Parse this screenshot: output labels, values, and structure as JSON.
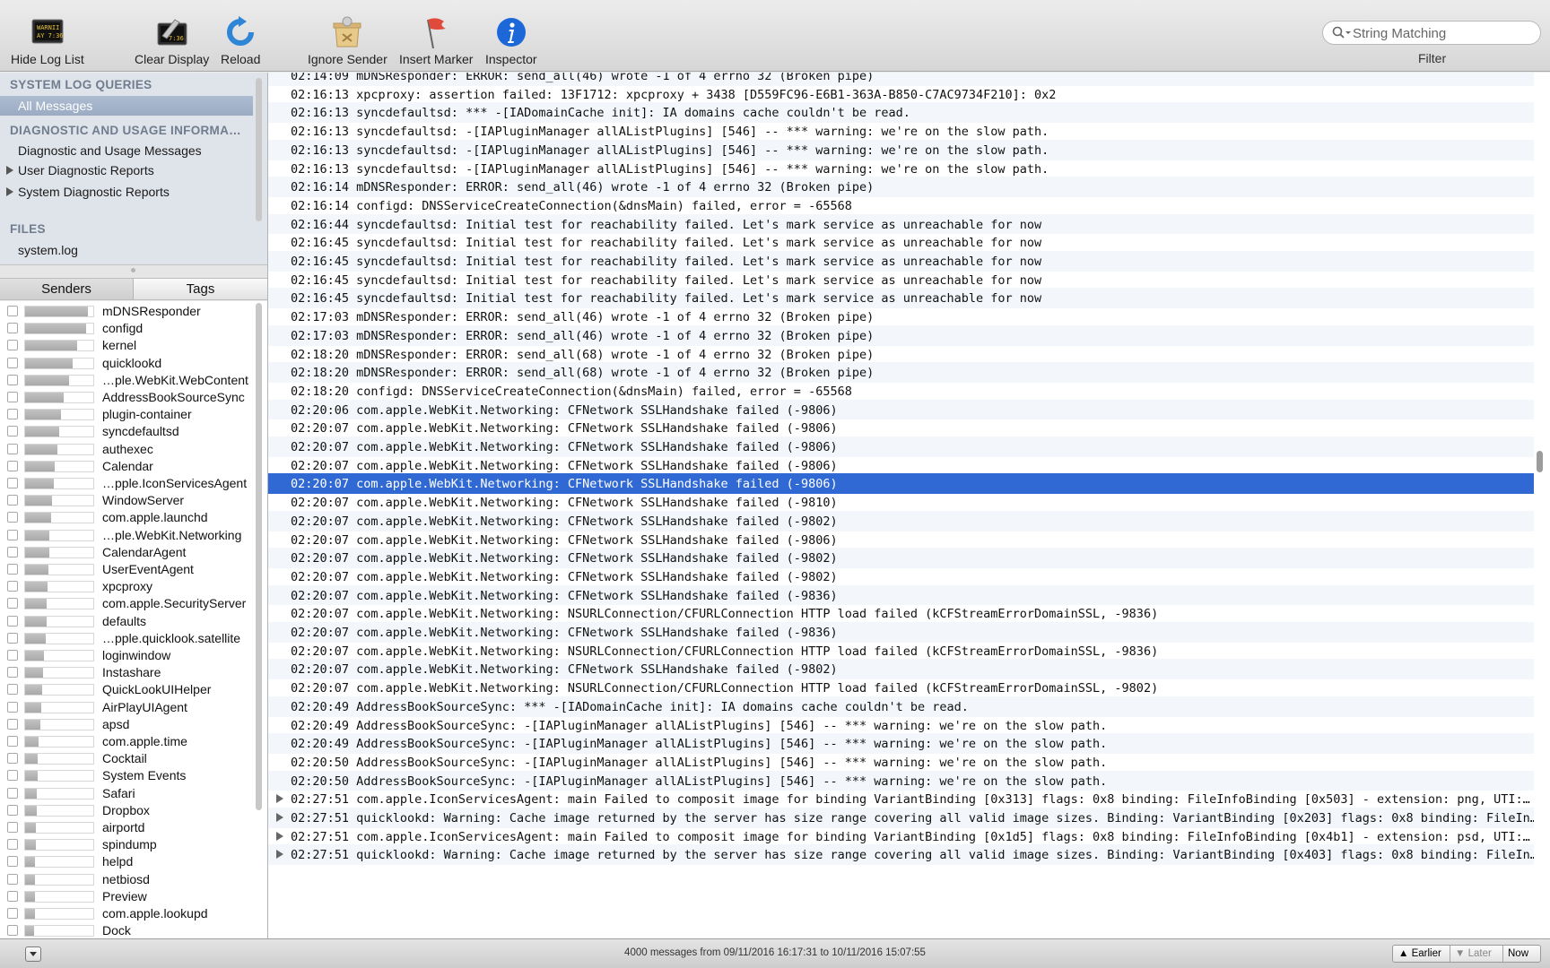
{
  "toolbar": {
    "hide_log_list": "Hide Log List",
    "clear_display": "Clear Display",
    "reload": "Reload",
    "ignore_sender": "Ignore Sender",
    "insert_marker": "Insert Marker",
    "inspector": "Inspector",
    "search_placeholder": "String Matching",
    "filter_label": "Filter",
    "console_icon_text_1": "WARNII",
    "console_icon_text_2": "AY 7:36",
    "clear_icon_text": "7:36"
  },
  "sidebar": {
    "system_log_queries": "SYSTEM LOG QUERIES",
    "all_messages": "All Messages",
    "diagnostic_header": "DIAGNOSTIC AND USAGE INFORMA…",
    "diagnostic_messages": "Diagnostic and Usage Messages",
    "user_reports": "User Diagnostic Reports",
    "system_reports": "System Diagnostic Reports",
    "files_header": "FILES",
    "system_log": "system.log"
  },
  "tabs": {
    "senders": "Senders",
    "tags": "Tags"
  },
  "senders": [
    {
      "name": "mDNSResponder",
      "level": 0.92
    },
    {
      "name": "configd",
      "level": 0.9
    },
    {
      "name": "kernel",
      "level": 0.76
    },
    {
      "name": "quicklookd",
      "level": 0.7
    },
    {
      "name": "…ple.WebKit.WebContent",
      "level": 0.64
    },
    {
      "name": "AddressBookSourceSync",
      "level": 0.57
    },
    {
      "name": "plugin-container",
      "level": 0.52
    },
    {
      "name": "syncdefaultsd",
      "level": 0.5
    },
    {
      "name": "authexec",
      "level": 0.48
    },
    {
      "name": "Calendar",
      "level": 0.44
    },
    {
      "name": "…pple.IconServicesAgent",
      "level": 0.42
    },
    {
      "name": "WindowServer",
      "level": 0.4
    },
    {
      "name": "com.apple.launchd",
      "level": 0.38
    },
    {
      "name": "…ple.WebKit.Networking",
      "level": 0.36
    },
    {
      "name": "CalendarAgent",
      "level": 0.35
    },
    {
      "name": "UserEventAgent",
      "level": 0.34
    },
    {
      "name": "xpcproxy",
      "level": 0.33
    },
    {
      "name": "com.apple.SecurityServer",
      "level": 0.32
    },
    {
      "name": "defaults",
      "level": 0.31
    },
    {
      "name": "…pple.quicklook.satellite",
      "level": 0.3
    },
    {
      "name": "loginwindow",
      "level": 0.28
    },
    {
      "name": "Instashare",
      "level": 0.26
    },
    {
      "name": "QuickLookUIHelper",
      "level": 0.25
    },
    {
      "name": "AirPlayUIAgent",
      "level": 0.24
    },
    {
      "name": "apsd",
      "level": 0.22
    },
    {
      "name": "com.apple.time",
      "level": 0.2
    },
    {
      "name": "Cocktail",
      "level": 0.19
    },
    {
      "name": "System Events",
      "level": 0.18
    },
    {
      "name": "Safari",
      "level": 0.17
    },
    {
      "name": "Dropbox",
      "level": 0.17
    },
    {
      "name": "airportd",
      "level": 0.16
    },
    {
      "name": "spindump",
      "level": 0.16
    },
    {
      "name": "helpd",
      "level": 0.15
    },
    {
      "name": "netbiosd",
      "level": 0.15
    },
    {
      "name": "Preview",
      "level": 0.14
    },
    {
      "name": "com.apple.lookupd",
      "level": 0.14
    },
    {
      "name": "Dock",
      "level": 0.13
    }
  ],
  "log": [
    {
      "t": "02:14:09 mDNSResponder: ERROR: send_all(46) wrote -1 of 4 errno 32 (Broken pipe)"
    },
    {
      "t": "02:16:13 xpcproxy: assertion failed: 13F1712: xpcproxy + 3438 [D559FC96-E6B1-363A-B850-C7AC9734F210]: 0x2"
    },
    {
      "t": "02:16:13 syncdefaultsd: *** -[IADomainCache init]: IA domains cache couldn't be read."
    },
    {
      "t": "02:16:13 syncdefaultsd: -[IAPluginManager allAListPlugins] [546] -- *** warning: we're on the slow path."
    },
    {
      "t": "02:16:13 syncdefaultsd: -[IAPluginManager allAListPlugins] [546] -- *** warning: we're on the slow path."
    },
    {
      "t": "02:16:13 syncdefaultsd: -[IAPluginManager allAListPlugins] [546] -- *** warning: we're on the slow path."
    },
    {
      "t": "02:16:14 mDNSResponder: ERROR: send_all(46) wrote -1 of 4 errno 32 (Broken pipe)"
    },
    {
      "t": "02:16:14 configd: DNSServiceCreateConnection(&dnsMain) failed, error = -65568"
    },
    {
      "t": "02:16:44 syncdefaultsd: Initial test for reachability failed. Let's mark service as unreachable for now"
    },
    {
      "t": "02:16:45 syncdefaultsd: Initial test for reachability failed. Let's mark service as unreachable for now"
    },
    {
      "t": "02:16:45 syncdefaultsd: Initial test for reachability failed. Let's mark service as unreachable for now"
    },
    {
      "t": "02:16:45 syncdefaultsd: Initial test for reachability failed. Let's mark service as unreachable for now"
    },
    {
      "t": "02:16:45 syncdefaultsd: Initial test for reachability failed. Let's mark service as unreachable for now"
    },
    {
      "t": "02:17:03 mDNSResponder: ERROR: send_all(46) wrote -1 of 4 errno 32 (Broken pipe)"
    },
    {
      "t": "02:17:03 mDNSResponder: ERROR: send_all(46) wrote -1 of 4 errno 32 (Broken pipe)"
    },
    {
      "t": "02:18:20 mDNSResponder: ERROR: send_all(68) wrote -1 of 4 errno 32 (Broken pipe)"
    },
    {
      "t": "02:18:20 mDNSResponder: ERROR: send_all(68) wrote -1 of 4 errno 32 (Broken pipe)"
    },
    {
      "t": "02:18:20 configd: DNSServiceCreateConnection(&dnsMain) failed, error = -65568"
    },
    {
      "t": "02:20:06 com.apple.WebKit.Networking: CFNetwork SSLHandshake failed (-9806)"
    },
    {
      "t": "02:20:07 com.apple.WebKit.Networking: CFNetwork SSLHandshake failed (-9806)"
    },
    {
      "t": "02:20:07 com.apple.WebKit.Networking: CFNetwork SSLHandshake failed (-9806)"
    },
    {
      "t": "02:20:07 com.apple.WebKit.Networking: CFNetwork SSLHandshake failed (-9806)"
    },
    {
      "t": "02:20:07 com.apple.WebKit.Networking: CFNetwork SSLHandshake failed (-9806)",
      "selected": true
    },
    {
      "t": "02:20:07 com.apple.WebKit.Networking: CFNetwork SSLHandshake failed (-9810)"
    },
    {
      "t": "02:20:07 com.apple.WebKit.Networking: CFNetwork SSLHandshake failed (-9802)"
    },
    {
      "t": "02:20:07 com.apple.WebKit.Networking: CFNetwork SSLHandshake failed (-9806)"
    },
    {
      "t": "02:20:07 com.apple.WebKit.Networking: CFNetwork SSLHandshake failed (-9802)"
    },
    {
      "t": "02:20:07 com.apple.WebKit.Networking: CFNetwork SSLHandshake failed (-9802)"
    },
    {
      "t": "02:20:07 com.apple.WebKit.Networking: CFNetwork SSLHandshake failed (-9836)"
    },
    {
      "t": "02:20:07 com.apple.WebKit.Networking: NSURLConnection/CFURLConnection HTTP load failed (kCFStreamErrorDomainSSL, -9836)"
    },
    {
      "t": "02:20:07 com.apple.WebKit.Networking: CFNetwork SSLHandshake failed (-9836)"
    },
    {
      "t": "02:20:07 com.apple.WebKit.Networking: NSURLConnection/CFURLConnection HTTP load failed (kCFStreamErrorDomainSSL, -9836)"
    },
    {
      "t": "02:20:07 com.apple.WebKit.Networking: CFNetwork SSLHandshake failed (-9802)"
    },
    {
      "t": "02:20:07 com.apple.WebKit.Networking: NSURLConnection/CFURLConnection HTTP load failed (kCFStreamErrorDomainSSL, -9802)"
    },
    {
      "t": "02:20:49 AddressBookSourceSync: *** -[IADomainCache init]: IA domains cache couldn't be read."
    },
    {
      "t": "02:20:49 AddressBookSourceSync: -[IAPluginManager allAListPlugins] [546] -- *** warning: we're on the slow path."
    },
    {
      "t": "02:20:49 AddressBookSourceSync: -[IAPluginManager allAListPlugins] [546] -- *** warning: we're on the slow path."
    },
    {
      "t": "02:20:50 AddressBookSourceSync: -[IAPluginManager allAListPlugins] [546] -- *** warning: we're on the slow path."
    },
    {
      "t": "02:20:50 AddressBookSourceSync: -[IAPluginManager allAListPlugins] [546] -- *** warning: we're on the slow path."
    },
    {
      "t": "02:27:51 com.apple.IconServicesAgent: main Failed to composit image for binding VariantBinding [0x313] flags: 0x8 binding: FileInfoBinding [0x503] - extension: png, UTI:…",
      "expandable": true
    },
    {
      "t": "02:27:51 quicklookd: Warning: Cache image returned by the server has size range covering all valid image sizes. Binding: VariantBinding [0x203] flags: 0x8 binding: FileIn…",
      "expandable": true
    },
    {
      "t": "02:27:51 com.apple.IconServicesAgent: main Failed to composit image for binding VariantBinding [0x1d5] flags: 0x8 binding: FileInfoBinding [0x4b1] - extension: psd, UTI:…",
      "expandable": true
    },
    {
      "t": "02:27:51 quicklookd: Warning: Cache image returned by the server has size range covering all valid image sizes. Binding: VariantBinding [0x403] flags: 0x8 binding: FileIn…",
      "expandable": true
    }
  ],
  "status": {
    "message": "4000 messages from 09/11/2016 16:17:31 to 10/11/2016 15:07:55",
    "earlier": "Earlier",
    "later": "Later",
    "now": "Now"
  },
  "colors": {
    "selection": "#3169d4",
    "sidebar_bg": "#dfe3ea",
    "section_header": "#6f7d8f",
    "inspector_blue": "#1c68d8"
  }
}
